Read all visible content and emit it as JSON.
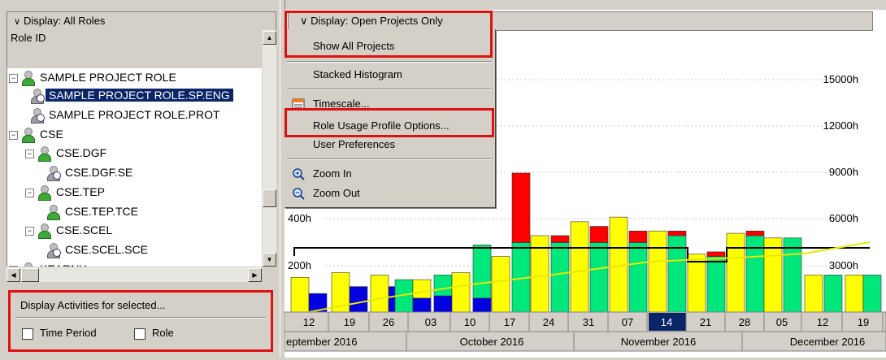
{
  "left_pane": {
    "display_dropdown": "Display: All Roles",
    "column_header": "Role ID",
    "tree": [
      {
        "label": "SAMPLE PROJECT ROLE",
        "level": 0,
        "expander": "−",
        "icon": "role-icon",
        "selected": false
      },
      {
        "label": "SAMPLE PROJECT ROLE.SP.ENG",
        "level": 1,
        "expander": "",
        "icon": "role-clock-icon",
        "selected": true
      },
      {
        "label": "SAMPLE PROJECT ROLE.PROT",
        "level": 1,
        "expander": "",
        "icon": "role-clock-icon",
        "selected": false
      },
      {
        "label": "CSE",
        "level": 0,
        "expander": "−",
        "icon": "role-icon",
        "selected": false
      },
      {
        "label": "CSE.DGF",
        "level": 1,
        "expander": "−",
        "icon": "role-icon",
        "selected": false
      },
      {
        "label": "CSE.DGF.SE",
        "level": 2,
        "expander": "",
        "icon": "role-clock-icon",
        "selected": false
      },
      {
        "label": "CSE.TEP",
        "level": 1,
        "expander": "−",
        "icon": "role-icon",
        "selected": false
      },
      {
        "label": "CSE.TEP.TCE",
        "level": 2,
        "expander": "",
        "icon": "role-icon",
        "selected": false
      },
      {
        "label": "CSE.SCEL",
        "level": 1,
        "expander": "−",
        "icon": "role-icon",
        "selected": false
      },
      {
        "label": "CSE.SCEL.SCE",
        "level": 2,
        "expander": "",
        "icon": "role-clock-icon",
        "selected": false
      },
      {
        "label": "KEARNY",
        "level": 0,
        "expander": "+",
        "icon": "role-icon",
        "selected": false
      }
    ],
    "activities_title": "Display Activities for selected...",
    "checkbox_time_period": "Time Period",
    "checkbox_role": "Role"
  },
  "chart_pane": {
    "display_dropdown": "Display: Open Projects Only"
  },
  "context_menu": {
    "items": [
      {
        "label": "Show All Projects",
        "icon": ""
      },
      {
        "label": "Stacked Histogram",
        "icon": ""
      },
      {
        "label": "Timescale...",
        "icon": "timescale-icon"
      },
      {
        "label": "Role Usage Profile Options...",
        "icon": ""
      },
      {
        "label": "User Preferences",
        "icon": ""
      },
      {
        "label": "Zoom In",
        "icon": "zoom-in-icon"
      },
      {
        "label": "Zoom Out",
        "icon": "zoom-out-icon"
      }
    ]
  },
  "chart_data": {
    "type": "bar",
    "left_axis_ticks": [
      "200h",
      "400h"
    ],
    "right_axis_ticks": [
      "3000h",
      "6000h",
      "9000h",
      "12000h",
      "15000h"
    ],
    "week_labels": [
      "12",
      "19",
      "26",
      "03",
      "10",
      "17",
      "24",
      "31",
      "07",
      "14",
      "21",
      "28",
      "05",
      "12",
      "19"
    ],
    "highlighted_week": "14",
    "month_labels": [
      "eptember 2016",
      "October 2016",
      "November 2016",
      "December 2016"
    ],
    "bar_colors": {
      "yellow": "#ffff00",
      "green": "#00e87c",
      "red": "#ff0000",
      "blue": "#0000e0"
    },
    "bars_yellow": [
      150,
      170,
      160,
      140,
      170,
      240,
      170,
      390,
      420,
      440,
      420,
      400,
      370,
      350,
      330,
      170
    ],
    "bars_green": [
      0,
      0,
      0,
      160,
      150,
      290,
      0,
      300,
      0,
      340,
      0,
      290,
      0,
      330,
      320,
      300,
      140,
      140
    ],
    "bars_red": [
      0,
      0,
      0,
      0,
      0,
      0,
      0,
      0,
      0,
      0,
      0,
      0,
      0,
      0,
      0
    ],
    "limit_line": "black",
    "cumulative_line": "yellow"
  }
}
